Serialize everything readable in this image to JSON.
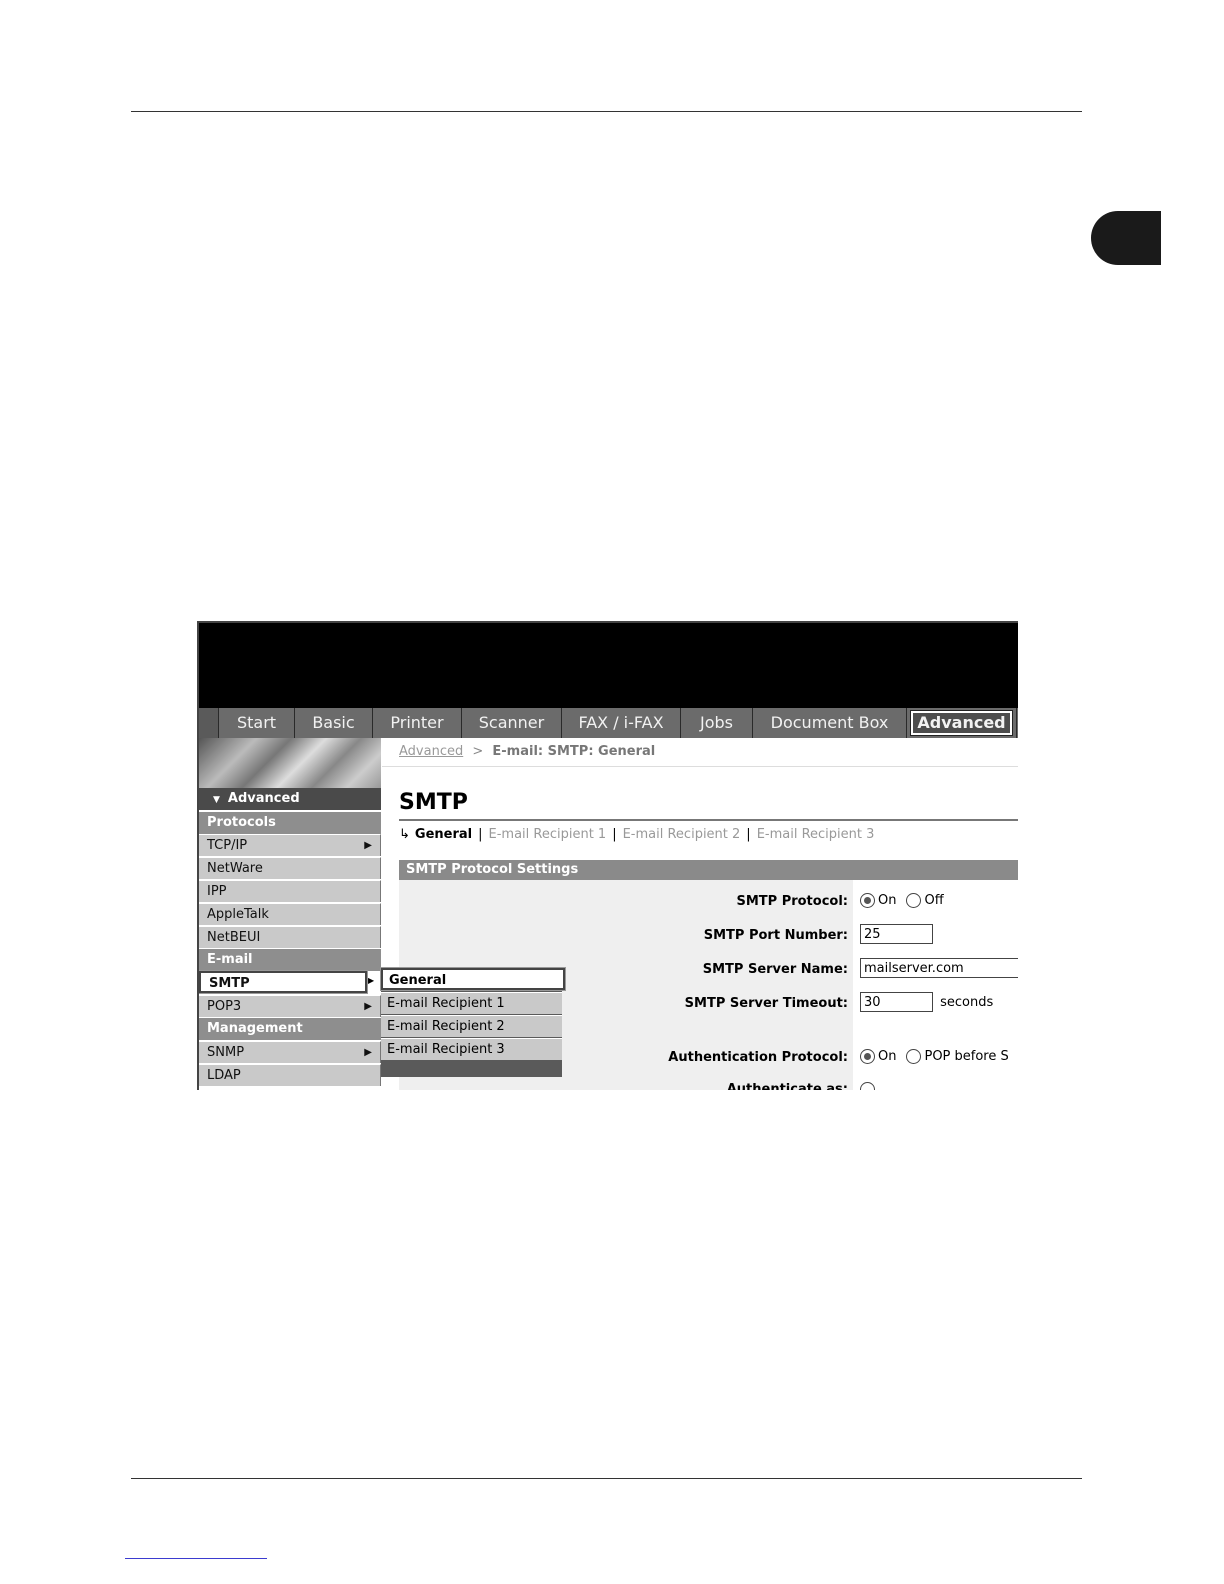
{
  "nav": {
    "tabs": [
      "Start",
      "Basic",
      "Printer",
      "Scanner",
      "FAX / i-FAX",
      "Jobs",
      "Document Box",
      "Advanced"
    ],
    "active": "Advanced"
  },
  "sidebar": {
    "header": "Advanced",
    "groups": {
      "protocols": "Protocols",
      "email": "E-mail",
      "management": "Management"
    },
    "items": {
      "tcpip": "TCP/IP",
      "netware": "NetWare",
      "ipp": "IPP",
      "appletalk": "AppleTalk",
      "netbeui": "NetBEUI",
      "smtp": "SMTP",
      "pop3": "POP3",
      "snmp": "SNMP",
      "ldap": "LDAP"
    }
  },
  "flyout": {
    "items": [
      "General",
      "E-mail Recipient 1",
      "E-mail Recipient 2",
      "E-mail Recipient 3"
    ]
  },
  "breadcrumb": {
    "link": "Advanced",
    "sep": ">",
    "current": "E-mail: SMTP: General"
  },
  "page": {
    "title": "SMTP",
    "subtabs": [
      "General",
      "E-mail Recipient 1",
      "E-mail Recipient 2",
      "E-mail Recipient 3"
    ],
    "section": "SMTP Protocol Settings"
  },
  "form": {
    "smtp_protocol": {
      "label": "SMTP Protocol:",
      "on": "On",
      "off": "Off"
    },
    "port": {
      "label": "SMTP Port Number:",
      "value": "25"
    },
    "server_name": {
      "label": "SMTP Server Name:",
      "value": "mailserver.com"
    },
    "timeout": {
      "label": "SMTP Server Timeout:",
      "value": "30",
      "unit": "seconds"
    },
    "auth_protocol": {
      "label": "Authentication Protocol:",
      "on": "On",
      "pop": "POP before S"
    },
    "authenticate_as": {
      "label": "Authenticate as:"
    }
  }
}
